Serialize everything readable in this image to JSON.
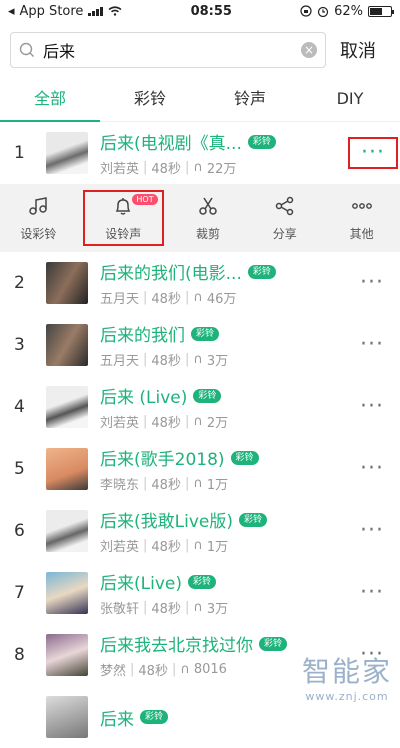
{
  "status": {
    "carrier": "App Store",
    "time": "08:55",
    "battery": "62%",
    "battery_level": 0.62
  },
  "search": {
    "query": "后来",
    "cancel": "取消"
  },
  "tabs": [
    {
      "label": "全部",
      "active": true
    },
    {
      "label": "彩铃"
    },
    {
      "label": "铃声"
    },
    {
      "label": "DIY"
    }
  ],
  "colors": {
    "accent": "#1db37b",
    "highlight": "#e02020",
    "hot": "#ff4d6d"
  },
  "results": [
    {
      "index": "1",
      "title": "后来(电视剧《真...",
      "badge": "彩铃",
      "artist": "刘若英",
      "duration": "48秒",
      "plays": "22万"
    },
    {
      "index": "2",
      "title": "后来的我们(电影...",
      "badge": "彩铃",
      "artist": "五月天",
      "duration": "48秒",
      "plays": "46万"
    },
    {
      "index": "3",
      "title": "后来的我们",
      "badge": "彩铃",
      "artist": "五月天",
      "duration": "48秒",
      "plays": "3万"
    },
    {
      "index": "4",
      "title": "后来 (Live)",
      "badge": "彩铃",
      "artist": "刘若英",
      "duration": "48秒",
      "plays": "2万"
    },
    {
      "index": "5",
      "title": "后来(歌手2018)",
      "badge": "彩铃",
      "artist": "李晓东",
      "duration": "48秒",
      "plays": "1万"
    },
    {
      "index": "6",
      "title": "后来(我敢Live版)",
      "badge": "彩铃",
      "artist": "刘若英",
      "duration": "48秒",
      "plays": "1万"
    },
    {
      "index": "7",
      "title": "后来(Live)",
      "badge": "彩铃",
      "artist": "张敬轩",
      "duration": "48秒",
      "plays": "3万"
    },
    {
      "index": "8",
      "title": "后来我去北京找过你",
      "badge": "彩铃",
      "artist": "梦然",
      "duration": "48秒",
      "plays": "8016"
    },
    {
      "index": "",
      "title": "后来",
      "badge": "彩铃",
      "artist": "",
      "duration": "",
      "plays": ""
    }
  ],
  "actions": [
    {
      "label": "设彩铃",
      "icon": "music-note-icon"
    },
    {
      "label": "设铃声",
      "icon": "bell-icon",
      "hot": "HOT"
    },
    {
      "label": "裁剪",
      "icon": "scissors-icon"
    },
    {
      "label": "分享",
      "icon": "share-icon"
    },
    {
      "label": "其他",
      "icon": "more-icon"
    }
  ],
  "more_label": "···",
  "watermark": {
    "main": "智能家",
    "sub": "www.znj.com"
  }
}
